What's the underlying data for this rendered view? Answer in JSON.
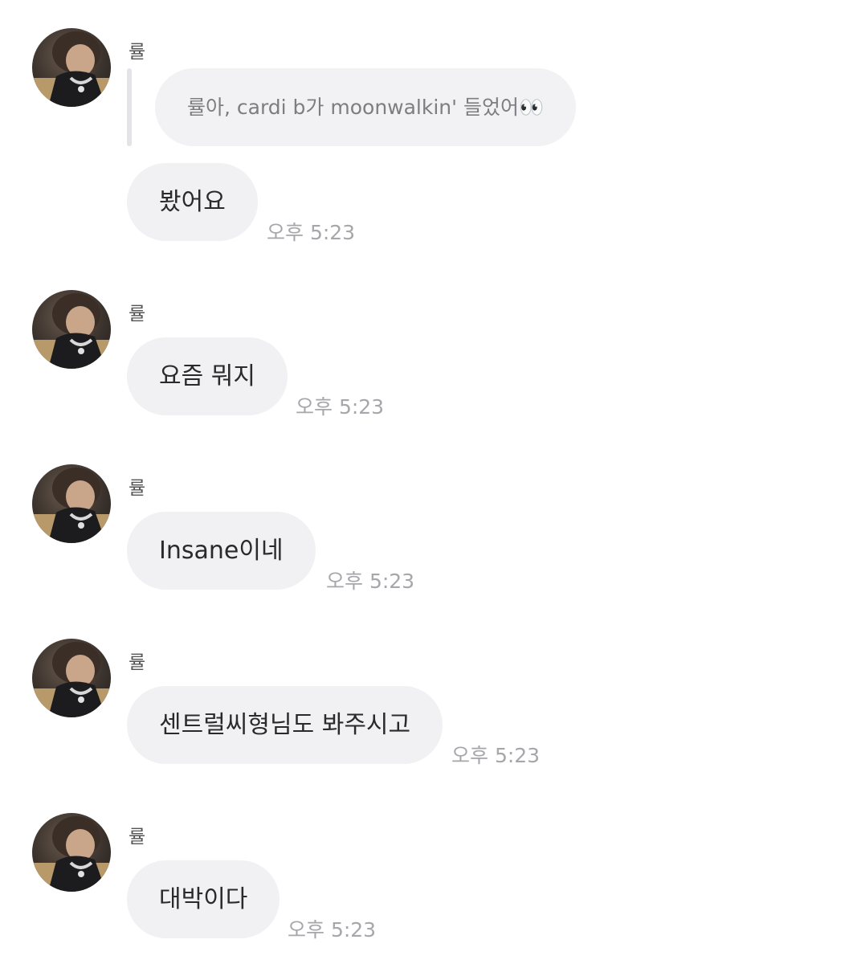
{
  "messages": [
    {
      "sender": "률",
      "reply_quote": "률아, cardi b가 moonwalkin' 들었어👀",
      "text": "봤어요",
      "time": "오후 5:23"
    },
    {
      "sender": "률",
      "text": "요즘 뭐지",
      "time": "오후 5:23"
    },
    {
      "sender": "률",
      "text": "Insane이네",
      "time": "오후 5:23"
    },
    {
      "sender": "률",
      "text": "센트럴씨형님도 봐주시고",
      "time": "오후 5:23"
    },
    {
      "sender": "률",
      "text": "대박이다",
      "time": "오후 5:23"
    }
  ],
  "colors": {
    "bubble_bg": "#f1f1f3",
    "time_text": "#a6a6ab",
    "quote_text": "#7d7d82"
  },
  "icons": {
    "avatar": "profile-photo"
  }
}
